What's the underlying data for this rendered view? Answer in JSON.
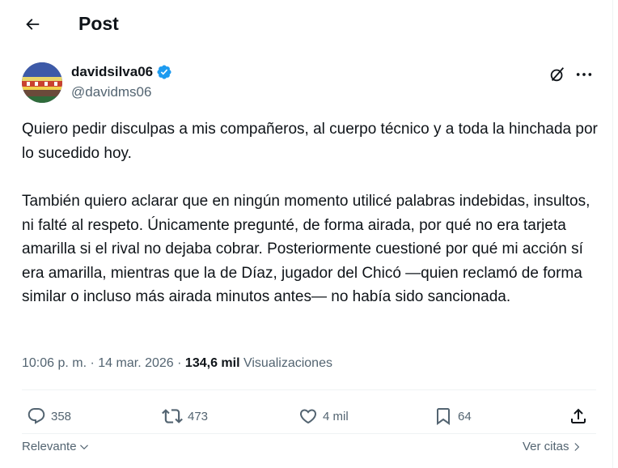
{
  "header": {
    "title": "Post",
    "back_icon": "arrow-left-icon"
  },
  "author": {
    "display_name": "davidsilva06",
    "handle": "@davidms06",
    "verified": true,
    "verified_color": "#1d9bf0"
  },
  "post": {
    "paragraph_1": "Quiero pedir disculpas a mis compañeros, al cuerpo técnico y a toda la hinchada por lo sucedido hoy.",
    "paragraph_2": "También quiero aclarar que en ningún momento utilicé palabras indebidas, insultos, ni falté al respeto. Únicamente pregunté, de forma airada, por qué no era tarjeta amarilla si el rival no dejaba cobrar. Posteriormente cuestioné por qué mi acción sí era amarilla, mientras que la de Díaz, jugador del Chicó —quien reclamó de forma similar o incluso más airada minutos antes— no había sido sancionada."
  },
  "meta": {
    "time": "10:06 p. m.",
    "separator": "·",
    "date": "14 mar. 2026",
    "views_count": "134,6 mil",
    "views_label": "Visualizaciones"
  },
  "actions": {
    "replies": "358",
    "reposts": "473",
    "likes": "4 mil",
    "bookmarks": "64"
  },
  "footer": {
    "sort_label": "Relevante",
    "quotes_label": "Ver citas"
  },
  "colors": {
    "text_primary": "#0f1419",
    "text_secondary": "#536471",
    "divider": "#eff3f4"
  }
}
